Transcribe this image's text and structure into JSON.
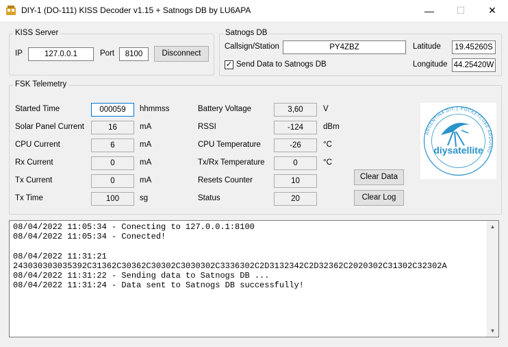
{
  "window": {
    "title": "DIY-1 (DO-111) KISS Decoder v1.15 + Satnogs DB by LU6APA",
    "minimize_glyph": "—",
    "maximize_glyph": "☐",
    "close_glyph": "✕"
  },
  "kiss_server": {
    "group_title": "KISS Server",
    "ip_label": "IP",
    "ip_value": "127.0.0.1",
    "port_label": "Port",
    "port_value": "8100",
    "disconnect_label": "Disconnect"
  },
  "satnogs": {
    "group_title": "Satnogs DB",
    "callsign_label": "Callsign/Station",
    "callsign_value": "PY4ZBZ",
    "send_checkbox_label": "Send Data to Satnogs DB",
    "send_checked": true,
    "latitude_label": "Latitude",
    "latitude_value": "19.45260S",
    "longitude_label": "Longitude",
    "longitude_value": "44.25420W"
  },
  "telemetry": {
    "group_title": "FSK Telemetry",
    "left": [
      {
        "label": "Started Time",
        "value": "000059",
        "unit": "hhmmss"
      },
      {
        "label": "Solar Panel Current",
        "value": "16",
        "unit": "mA"
      },
      {
        "label": "CPU Current",
        "value": "6",
        "unit": "mA"
      },
      {
        "label": "Rx Current",
        "value": "0",
        "unit": "mA"
      },
      {
        "label": "Tx Current",
        "value": "0",
        "unit": "mA"
      },
      {
        "label": "Tx Time",
        "value": "100",
        "unit": "sg"
      }
    ],
    "right": [
      {
        "label": "Battery Voltage",
        "value": "3,60",
        "unit": "V"
      },
      {
        "label": "RSSI",
        "value": "-124",
        "unit": "dBm"
      },
      {
        "label": "CPU Temperature",
        "value": "-26",
        "unit": "°C"
      },
      {
        "label": "Tx/Rx Temperature",
        "value": "0",
        "unit": "°C"
      },
      {
        "label": "Resets Counter",
        "value": "10",
        "unit": ""
      },
      {
        "label": "Status",
        "value": "20",
        "unit": ""
      }
    ],
    "clear_data_label": "Clear Data",
    "clear_log_label": "Clear Log"
  },
  "logo": {
    "text": "diysatellite",
    "ring_text": "ARGENTINA DIY-1 POCKETCUBE ARDUINO"
  },
  "log": [
    "08/04/2022 11:05:34 - Conecting to 127.0.0.1:8100",
    "08/04/2022 11:05:34 - Conected!",
    "",
    "08/04/2022 11:31:21",
    "243030303035392C31362C30362C30302C3030302C3336302C2D3132342C2D32362C2020302C31302C32302A",
    "08/04/2022 11:31:22 - Sending data to Satnogs DB ...",
    "08/04/2022 11:31:24 - Data sent to Satnogs DB successfully!"
  ],
  "colors": {
    "window_bg": "#f0f0f0",
    "logo_blue": "#2a93c9"
  },
  "icons": {
    "app": "app-icon",
    "checkbox": "check-icon"
  }
}
